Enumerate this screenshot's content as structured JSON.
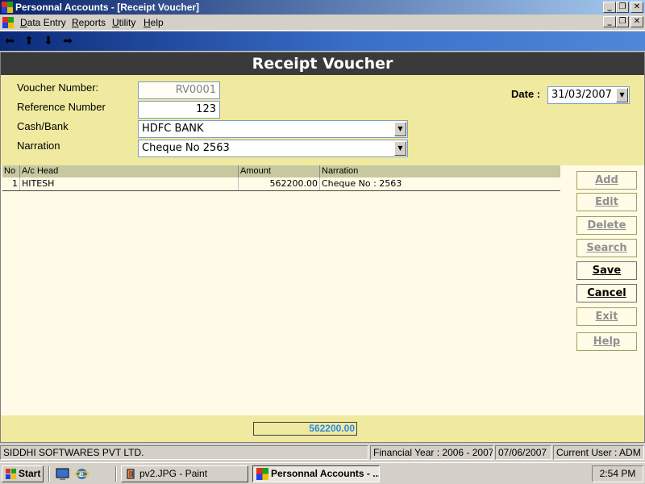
{
  "window": {
    "title": "Personnal Accounts - [Receipt Voucher]"
  },
  "menu": {
    "items": [
      "Data Entry",
      "Reports",
      "Utility",
      "Help"
    ]
  },
  "nav": {
    "icons": [
      "arrow-left-icon",
      "arrow-up-icon",
      "arrow-down-icon",
      "arrow-right-icon"
    ]
  },
  "form": {
    "title": "Receipt Voucher",
    "voucher_number_label": "Voucher Number:",
    "voucher_number": "RV0001",
    "reference_number_label": "Reference Number",
    "reference_number": "123",
    "cash_bank_label": "Cash/Bank",
    "cash_bank": "HDFC BANK",
    "narration_label": "Narration",
    "narration": "Cheque No 2563",
    "date_label": "Date :",
    "date": "31/03/2007"
  },
  "grid": {
    "columns": [
      "No",
      "A/c Head",
      "Amount",
      "Narration"
    ],
    "rows": [
      {
        "no": "1",
        "head": "HITESH",
        "amount": "562200.00",
        "narration": "Cheque No : 2563"
      }
    ]
  },
  "buttons": {
    "add": "Add",
    "edit": "Edit",
    "delete": "Delete",
    "search": "Search",
    "save": "Save",
    "cancel": "Cancel",
    "exit": "Exit",
    "help": "Help"
  },
  "total": "562200.00",
  "status": {
    "company": "SIDDHI SOFTWARES PVT LTD.",
    "financial_year": "Financial Year : 2006 - 2007",
    "date": "07/06/2007",
    "user": "Current User : ADM"
  },
  "taskbar": {
    "start": "Start",
    "tasks": [
      "pv2.JPG - Paint",
      "Personnal Accounts - ..."
    ],
    "clock": "2:54 PM"
  },
  "colors": {
    "title_bar": "#0a246a",
    "panel": "#f0e9a0",
    "background": "#fffbe6",
    "total_text": "#2a8ae8",
    "form_title": "#3a3a3a"
  }
}
